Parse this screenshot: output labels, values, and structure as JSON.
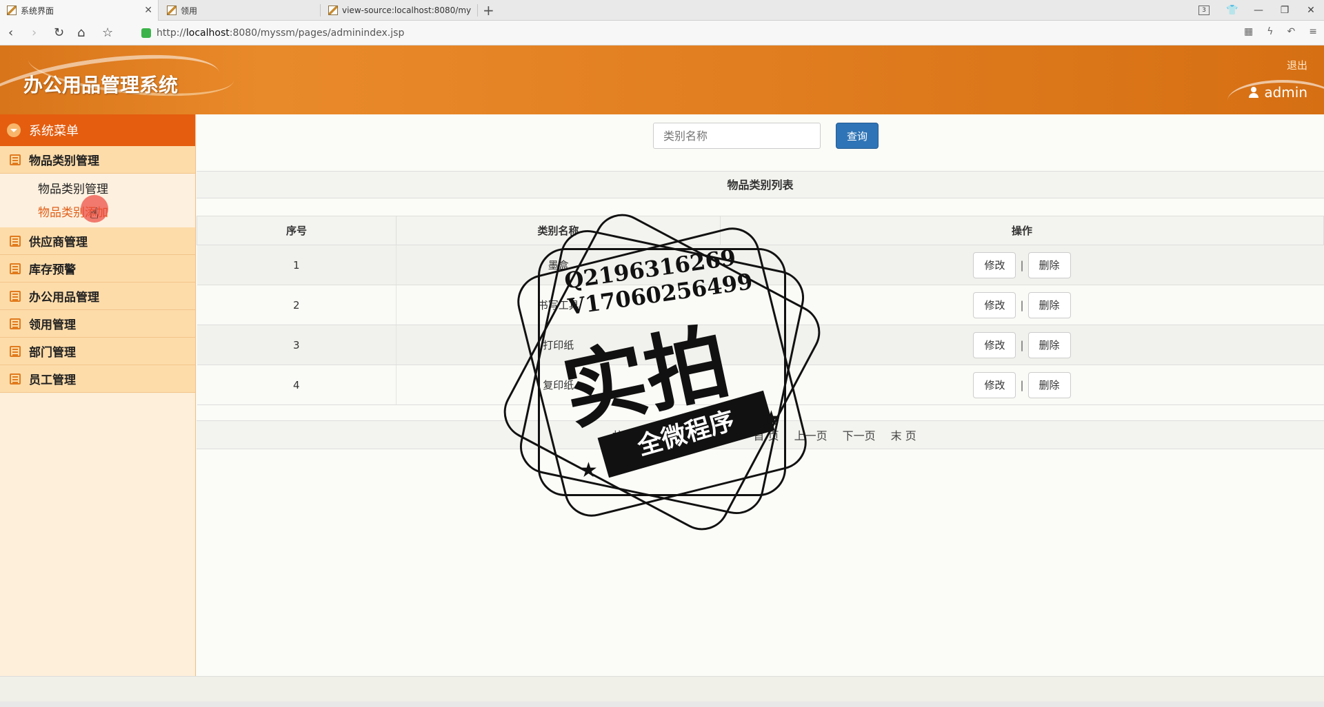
{
  "browser": {
    "tabs": [
      {
        "title": "系统界面",
        "active": true
      },
      {
        "title": "领用",
        "active": false
      },
      {
        "title": "view-source:localhost:8080/my",
        "active": false
      }
    ],
    "tab_count": "3",
    "url_prefix": "http://",
    "url_host": "localhost",
    "url_rest": ":8080/myssm/pages/adminindex.jsp"
  },
  "header": {
    "title": "办公用品管理系统",
    "logout": "退出",
    "username": "admin"
  },
  "sidebar": {
    "menu_title": "系统菜单",
    "groups": [
      {
        "label": "物品类别管理",
        "items": [
          {
            "label": "物品类别管理",
            "active": false
          },
          {
            "label": "物品类别添加",
            "active": true
          }
        ]
      },
      {
        "label": "供应商管理"
      },
      {
        "label": "库存预警"
      },
      {
        "label": "办公用品管理"
      },
      {
        "label": "领用管理"
      },
      {
        "label": "部门管理"
      },
      {
        "label": "员工管理"
      }
    ]
  },
  "search": {
    "placeholder": "类别名称",
    "button": "查询"
  },
  "list": {
    "title": "物品类别列表",
    "columns": [
      "序号",
      "类别名称",
      "操作"
    ],
    "rows": [
      {
        "no": "1",
        "name": "墨盒"
      },
      {
        "no": "2",
        "name": "书写工具"
      },
      {
        "no": "3",
        "name": "打印纸"
      },
      {
        "no": "4",
        "name": "复印纸"
      }
    ],
    "edit_label": "修改",
    "delete_label": "删除",
    "op_sep": "|"
  },
  "pager": {
    "total_prefix": "共",
    "total_count": "4",
    "total_suffix": "条记录",
    "per_page": "每页",
    "first": "首 页",
    "prev": "上一页",
    "next": "下一页",
    "last": "末 页"
  },
  "watermark": {
    "line1": "Q2196316269",
    "line2": "V17060256499",
    "main": "实拍",
    "ribbon": "全微程序"
  }
}
